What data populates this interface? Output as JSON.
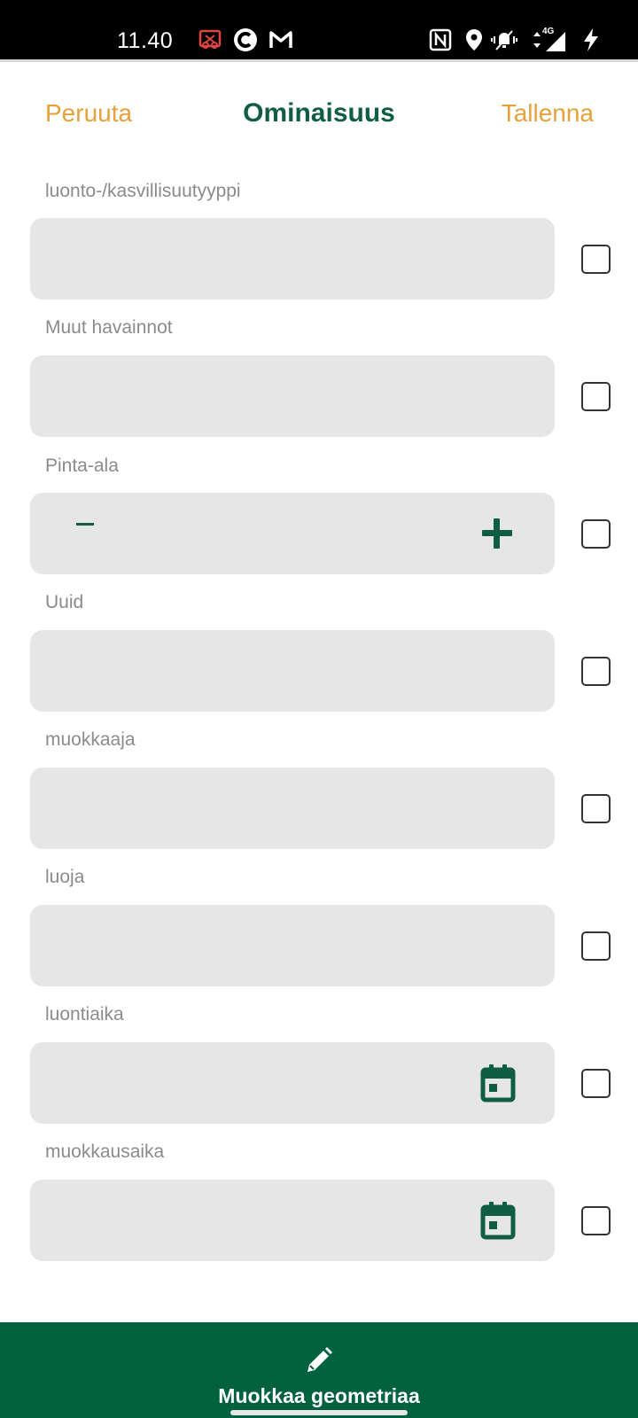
{
  "status_bar": {
    "time": "11.40",
    "network": "4G",
    "icons": [
      "screenshot-icon",
      "c-app-icon",
      "gmail-icon",
      "nfc-icon",
      "location-icon",
      "vibrate-icon",
      "data-arrows-icon",
      "signal-icon",
      "charging-icon"
    ]
  },
  "header": {
    "cancel_label": "Peruuta",
    "title": "Ominaisuus",
    "save_label": "Tallenna"
  },
  "fields": [
    {
      "label": "luonto-/kasvillisuutyyppi",
      "value": "",
      "type": "text",
      "checked": false
    },
    {
      "label": "Muut havainnot",
      "value": "",
      "type": "text",
      "checked": false
    },
    {
      "label": "Pinta-ala",
      "value": "",
      "type": "stepper",
      "checked": false
    },
    {
      "label": "Uuid",
      "value": "",
      "type": "text",
      "checked": false
    },
    {
      "label": "muokkaaja",
      "value": "",
      "type": "text",
      "checked": false
    },
    {
      "label": "luoja",
      "value": "",
      "type": "text",
      "checked": false
    },
    {
      "label": "luontiaika",
      "value": "",
      "type": "date",
      "checked": false
    },
    {
      "label": "muokkausaika",
      "value": "",
      "type": "date",
      "checked": false
    }
  ],
  "bottom_bar": {
    "label": "Muokkaa geometriaa",
    "icon": "pencil-icon"
  },
  "colors": {
    "accent_orange": "#e8a03a",
    "brand_green": "#0f5e44",
    "bottom_bar": "#00613f",
    "field_bg": "#e6e6e6"
  }
}
